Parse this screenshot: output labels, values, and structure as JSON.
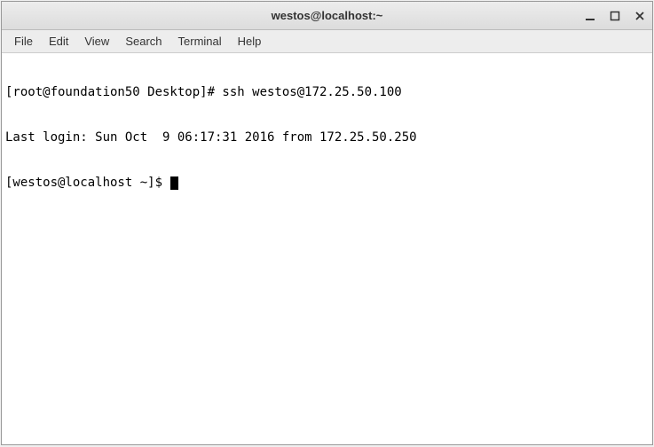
{
  "window": {
    "title": "westos@localhost:~"
  },
  "menubar": {
    "file": "File",
    "edit": "Edit",
    "view": "View",
    "search": "Search",
    "terminal": "Terminal",
    "help": "Help"
  },
  "terminal": {
    "line1": "[root@foundation50 Desktop]# ssh westos@172.25.50.100",
    "line2": "Last login: Sun Oct  9 06:17:31 2016 from 172.25.50.250",
    "line3_prompt": "[westos@localhost ~]$ "
  }
}
